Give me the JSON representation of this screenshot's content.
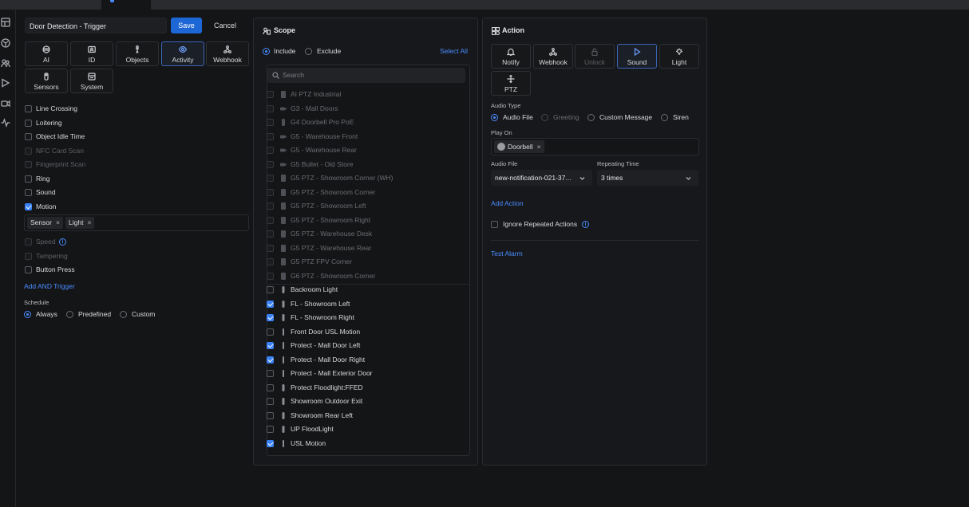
{
  "trigger": {
    "name": "Door Detection - Trigger",
    "save_label": "Save",
    "cancel_label": "Cancel",
    "categories": [
      {
        "label": "AI",
        "icon": "ai-icon"
      },
      {
        "label": "ID",
        "icon": "id-icon"
      },
      {
        "label": "Objects",
        "icon": "person-icon"
      },
      {
        "label": "Activity",
        "icon": "eye-icon",
        "active": true
      },
      {
        "label": "Webhook",
        "icon": "webhook-icon"
      },
      {
        "label": "Sensors",
        "icon": "sensor-icon"
      },
      {
        "label": "System",
        "icon": "system-icon"
      }
    ],
    "items": [
      {
        "label": "Line Crossing",
        "checked": false,
        "disabled": false
      },
      {
        "label": "Loitering",
        "checked": false,
        "disabled": false
      },
      {
        "label": "Object Idle Time",
        "checked": false,
        "disabled": false
      },
      {
        "label": "NFC Card Scan",
        "checked": false,
        "disabled": true
      },
      {
        "label": "Fingerprint Scan",
        "checked": false,
        "disabled": true
      },
      {
        "label": "Ring",
        "checked": false,
        "disabled": false
      },
      {
        "label": "Sound",
        "checked": false,
        "disabled": false
      },
      {
        "label": "Motion",
        "checked": true,
        "disabled": false
      }
    ],
    "motion_tags": [
      "Sensor",
      "Light"
    ],
    "items_after": [
      {
        "label": "Speed",
        "checked": false,
        "disabled": true,
        "info": true
      },
      {
        "label": "Tampering",
        "checked": false,
        "disabled": true
      },
      {
        "label": "Button Press",
        "checked": false,
        "disabled": false
      }
    ],
    "add_and_trigger": "Add AND Trigger",
    "schedule_label": "Schedule",
    "schedule_options": [
      "Always",
      "Predefined",
      "Custom"
    ],
    "schedule_selected": "Always"
  },
  "scope": {
    "title": "Scope",
    "include_label": "Include",
    "exclude_label": "Exclude",
    "mode": "Include",
    "select_all": "Select All",
    "search_placeholder": "Search",
    "cameras": [
      {
        "name": "AI PTZ Industrial",
        "checked": false,
        "disabled": true,
        "icon": "ptz-camera-icon"
      },
      {
        "name": "G3 - Mall Doors",
        "checked": false,
        "disabled": true,
        "icon": "bullet-camera-icon"
      },
      {
        "name": "G4 Doorbell Pro PoE",
        "checked": false,
        "disabled": true,
        "icon": "doorbell-icon"
      },
      {
        "name": "G5 - Warehouse Front",
        "checked": false,
        "disabled": true,
        "icon": "bullet-camera-icon"
      },
      {
        "name": "G5 - Warehouse Rear",
        "checked": false,
        "disabled": true,
        "icon": "bullet-camera-icon"
      },
      {
        "name": "G5 Bullet - Old Store",
        "checked": false,
        "disabled": true,
        "icon": "bullet-camera-icon"
      },
      {
        "name": "G5 PTZ - Showroom Corner (WH)",
        "checked": false,
        "disabled": true,
        "icon": "ptz-camera-icon"
      },
      {
        "name": "G5 PTZ - Showroom Corner",
        "checked": false,
        "disabled": true,
        "icon": "ptz-camera-icon"
      },
      {
        "name": "G5 PTZ - Showroom Left",
        "checked": false,
        "disabled": true,
        "icon": "ptz-camera-icon"
      },
      {
        "name": "G5 PTZ - Showroom Right",
        "checked": false,
        "disabled": true,
        "icon": "ptz-camera-icon"
      },
      {
        "name": "G5 PTZ - Warehouse Desk",
        "checked": false,
        "disabled": true,
        "icon": "ptz-camera-icon"
      },
      {
        "name": "G5 PTZ - Warehouse Rear",
        "checked": false,
        "disabled": true,
        "icon": "ptz-camera-icon"
      },
      {
        "name": "G5 PTZ FPV Corner",
        "checked": false,
        "disabled": true,
        "icon": "ptz-camera-icon"
      },
      {
        "name": "G6 PTZ - Showroom Corner",
        "checked": false,
        "disabled": true,
        "icon": "ptz-camera-icon"
      },
      {
        "name": "Backroom Light",
        "checked": false,
        "disabled": false,
        "icon": "light-icon"
      },
      {
        "name": "FL - Showroom Left",
        "checked": true,
        "disabled": false,
        "icon": "light-icon"
      },
      {
        "name": "FL - Showroom Right",
        "checked": true,
        "disabled": false,
        "icon": "light-icon"
      },
      {
        "name": "Front Door USL Motion",
        "checked": false,
        "disabled": false,
        "icon": "sensor-icon"
      },
      {
        "name": "Protect - Mall Door Left",
        "checked": true,
        "disabled": false,
        "icon": "sensor-icon"
      },
      {
        "name": "Protect - Mall Door Right",
        "checked": true,
        "disabled": false,
        "icon": "sensor-icon"
      },
      {
        "name": "Protect - Mall Exterior Door",
        "checked": false,
        "disabled": false,
        "icon": "sensor-icon"
      },
      {
        "name": "Protect Floodlight:FFED",
        "checked": false,
        "disabled": false,
        "icon": "light-icon"
      },
      {
        "name": "Showroom Outdoor Exit",
        "checked": false,
        "disabled": false,
        "icon": "light-icon"
      },
      {
        "name": "Showroom Rear Left",
        "checked": false,
        "disabled": false,
        "icon": "light-icon"
      },
      {
        "name": "UP FloodLight",
        "checked": false,
        "disabled": false,
        "icon": "light-icon"
      },
      {
        "name": "USL Motion",
        "checked": true,
        "disabled": false,
        "icon": "sensor-icon"
      }
    ]
  },
  "action": {
    "title": "Action",
    "types": [
      {
        "label": "Notify",
        "icon": "bell-icon"
      },
      {
        "label": "Webhook",
        "icon": "webhook-icon"
      },
      {
        "label": "Unlock",
        "icon": "lock-icon",
        "disabled": true
      },
      {
        "label": "Sound",
        "icon": "play-icon",
        "active": true
      },
      {
        "label": "Light",
        "icon": "bulb-icon"
      },
      {
        "label": "PTZ",
        "icon": "ptz-move-icon"
      }
    ],
    "audio_type_label": "Audio Type",
    "audio_types": [
      {
        "label": "Audio File",
        "selected": true,
        "disabled": false
      },
      {
        "label": "Greeting",
        "selected": false,
        "disabled": true
      },
      {
        "label": "Custom Message",
        "selected": false,
        "disabled": false
      },
      {
        "label": "Siren",
        "selected": false,
        "disabled": false
      }
    ],
    "play_on_label": "Play On",
    "play_on_tags": [
      "Doorbell"
    ],
    "audio_file_label": "Audio File",
    "audio_file_value": "new-notification-021-37...",
    "repeating_label": "Repeating Time",
    "repeating_value": "3 times",
    "add_action": "Add Action",
    "ignore_repeated": "Ignore Repeated Actions",
    "test_alarm": "Test Alarm"
  },
  "colors": {
    "accent": "#1d66d6",
    "link": "#4a8cff",
    "background": "#141517",
    "panel": "#17181b"
  }
}
